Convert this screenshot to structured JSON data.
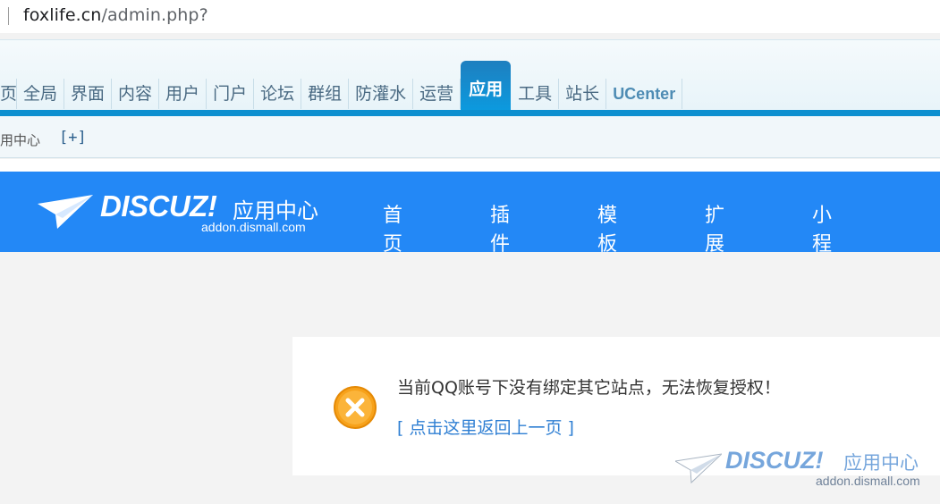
{
  "browser": {
    "url_host": "foxlife.cn",
    "url_path": "/admin.php?"
  },
  "admin_nav": {
    "items": [
      {
        "label": "页",
        "name": "nav-item-home-partial"
      },
      {
        "label": "全局",
        "name": "nav-item-global"
      },
      {
        "label": "界面",
        "name": "nav-item-style"
      },
      {
        "label": "内容",
        "name": "nav-item-content"
      },
      {
        "label": "用户",
        "name": "nav-item-user"
      },
      {
        "label": "门户",
        "name": "nav-item-portal"
      },
      {
        "label": "论坛",
        "name": "nav-item-forum"
      },
      {
        "label": "群组",
        "name": "nav-item-group"
      },
      {
        "label": "防灌水",
        "name": "nav-item-safe"
      },
      {
        "label": "运营",
        "name": "nav-item-extended"
      },
      {
        "label": "应用",
        "name": "nav-item-plugin",
        "active": true
      },
      {
        "label": "工具",
        "name": "nav-item-tools"
      },
      {
        "label": "站长",
        "name": "nav-item-founder"
      },
      {
        "label": "UCenter",
        "name": "nav-item-ucenter"
      }
    ],
    "active_color": "#0b9be0"
  },
  "subnav": {
    "label": "用中心",
    "add_label": "[+]"
  },
  "app_header": {
    "brand_word": "DISCUZ!",
    "brand_cn": "应用中心",
    "brand_domain": "addon.dismall.com",
    "nav": [
      {
        "label": "首页",
        "name": "app-nav-home"
      },
      {
        "label": "插件",
        "name": "app-nav-plugins"
      },
      {
        "label": "模板",
        "name": "app-nav-templates"
      },
      {
        "label": "扩展",
        "name": "app-nav-extensions"
      },
      {
        "label": "小程序",
        "name": "app-nav-miniprogram"
      }
    ],
    "bg_color": "#2388f6"
  },
  "message": {
    "text": "当前QQ账号下没有绑定其它站点，无法恢复授权！",
    "back_link": "[ 点击这里返回上一页 ]",
    "icon": "error-x-icon",
    "icon_color": "#f7a21b"
  },
  "watermark": {
    "brand_word": "DISCUZ!",
    "brand_cn": "应用中心",
    "brand_domain": "addon.dismall.com"
  }
}
